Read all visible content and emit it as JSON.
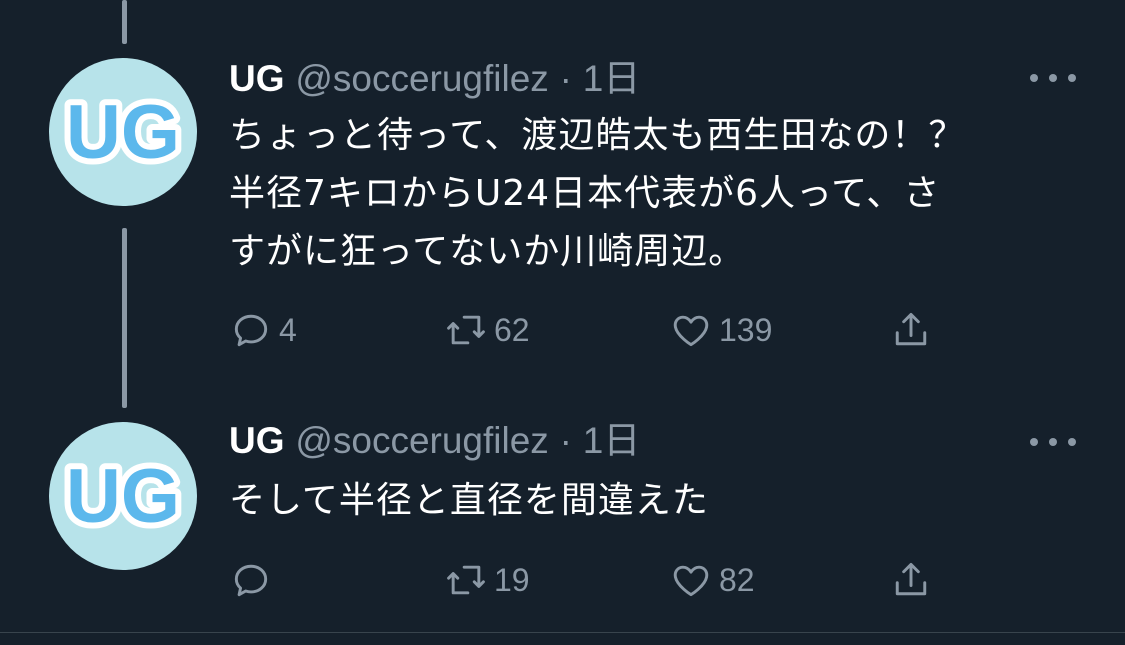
{
  "tweets": [
    {
      "name": "UG",
      "handle": "@soccerugfilez",
      "separator": "·",
      "time": "1日",
      "avatar_text": "UG",
      "lines": [
        "ちょっと待って、渡辺皓太も西生田なの！？",
        "半径7キロからU24日本代表が6人って、さ",
        "すがに狂ってないか川崎周辺。"
      ],
      "replies": "4",
      "retweets": "62",
      "likes": "139"
    },
    {
      "name": "UG",
      "handle": "@soccerugfilez",
      "separator": "·",
      "time": "1日",
      "avatar_text": "UG",
      "lines": [
        "そして半径と直径を間違えた"
      ],
      "replies": "",
      "retweets": "19",
      "likes": "82"
    }
  ],
  "colors": {
    "background": "#15202b",
    "secondary_text": "#8b98a5",
    "avatar_bg": "#b7e3ea",
    "avatar_letters": "#5cb8ec"
  }
}
